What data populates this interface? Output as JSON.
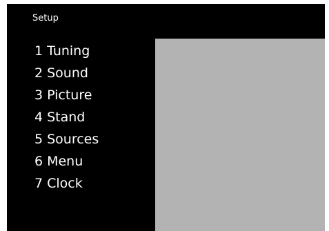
{
  "header": {
    "title": "Setup"
  },
  "menu": {
    "items": [
      {
        "number": "1",
        "label": "Tuning"
      },
      {
        "number": "2",
        "label": "Sound"
      },
      {
        "number": "3",
        "label": "Picture"
      },
      {
        "number": "4",
        "label": "Stand"
      },
      {
        "number": "5",
        "label": "Sources"
      },
      {
        "number": "6",
        "label": "Menu"
      },
      {
        "number": "7",
        "label": "Clock"
      }
    ]
  },
  "colors": {
    "background": "#000000",
    "text": "#ffffff",
    "preview_panel": "#b3b3b3",
    "page": "#ffffff"
  }
}
